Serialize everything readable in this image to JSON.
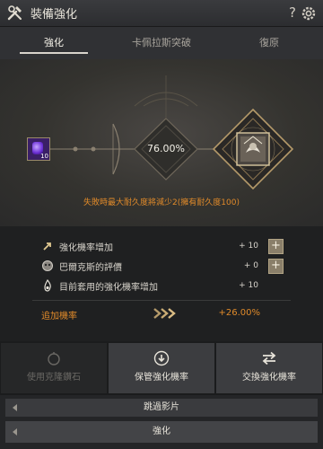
{
  "window": {
    "title": "裝備強化",
    "help_label": "?"
  },
  "tabs": [
    {
      "label": "強化",
      "active": true
    },
    {
      "label": "卡佩拉斯突破",
      "active": false
    },
    {
      "label": "復原",
      "active": false
    }
  ],
  "stage": {
    "material_count": "10",
    "success_rate": "76.00%",
    "fail_message": "失敗時最大耐久度將減少2(擁有耐久度100)"
  },
  "stats": [
    {
      "icon": "arrow-up-icon",
      "label": "強化機率增加",
      "value": "+ 10",
      "has_add": true
    },
    {
      "icon": "skull-icon",
      "label": "巴爾克斯的評價",
      "value": "+ 0",
      "has_add": true
    },
    {
      "icon": "flame-icon",
      "label": "目前套用的強化機率增加",
      "value": "+ 10",
      "has_add": false
    }
  ],
  "additional": {
    "label": "追加機率",
    "value": "+26.00%"
  },
  "actions": [
    {
      "label": "使用克隆鑽石",
      "icon": "stone-icon",
      "enabled": false
    },
    {
      "label": "保管強化機率",
      "icon": "download-icon",
      "enabled": true
    },
    {
      "label": "交換強化機率",
      "icon": "swap-icon",
      "enabled": true
    }
  ],
  "skip_label": "跳過影片",
  "enhance_label": "強化",
  "colors": {
    "accent_orange": "#e08a2a",
    "gold": "#b59a6a",
    "material_purple": "#3a1f66"
  }
}
